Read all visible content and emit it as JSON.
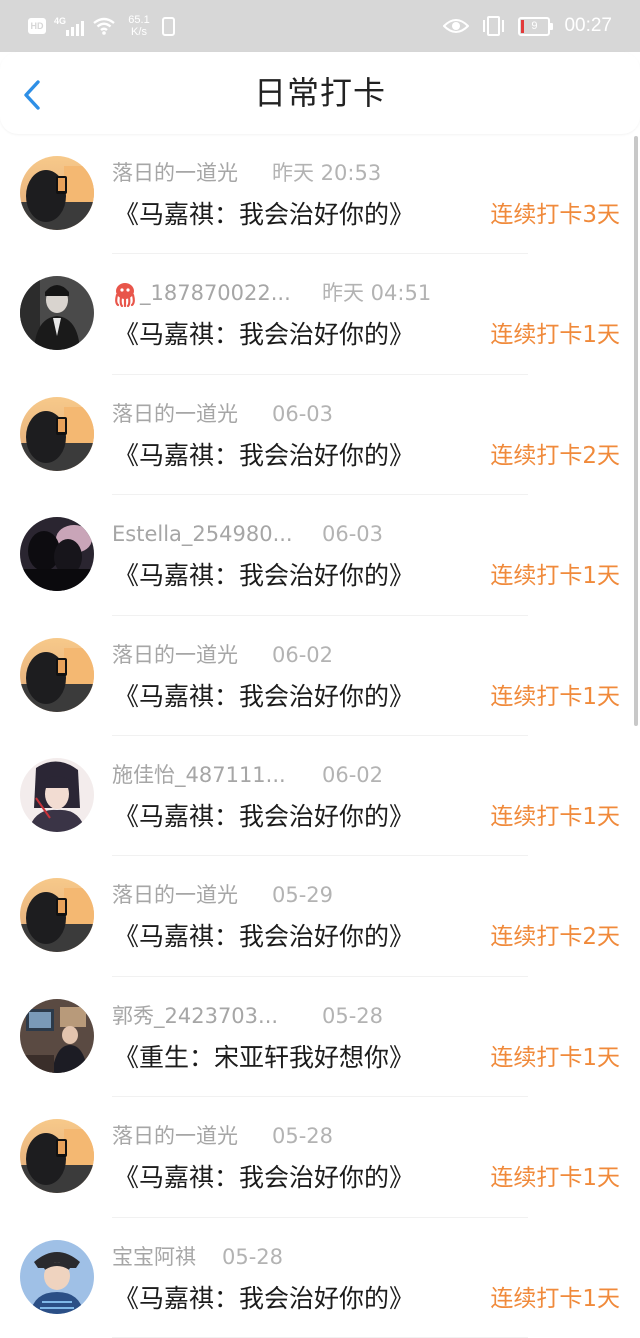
{
  "status_bar": {
    "hd": "HD",
    "network": "4G",
    "speed_value": "65.1",
    "speed_unit": "K/s",
    "battery": "9",
    "time": "00:27"
  },
  "header": {
    "title": "日常打卡",
    "back_icon": "chevron-left-icon"
  },
  "checkins": [
    {
      "user": "落日的一道光",
      "time": "昨天 20:53",
      "book": "《马嘉祺：我会治好你的》",
      "streak": "连续打卡3天"
    },
    {
      "user": "_187870022...",
      "user_emoji": "octopus",
      "time": "昨天 04:51",
      "book": "《马嘉祺：我会治好你的》",
      "streak": "连续打卡1天"
    },
    {
      "user": "落日的一道光",
      "time": "06-03",
      "book": "《马嘉祺：我会治好你的》",
      "streak": "连续打卡2天"
    },
    {
      "user": "Estella_254980...",
      "time": "06-03",
      "book": "《马嘉祺：我会治好你的》",
      "streak": "连续打卡1天"
    },
    {
      "user": "落日的一道光",
      "time": "06-02",
      "book": "《马嘉祺：我会治好你的》",
      "streak": "连续打卡1天"
    },
    {
      "user": "施佳怡_487111...",
      "time": "06-02",
      "book": "《马嘉祺：我会治好你的》",
      "streak": "连续打卡1天"
    },
    {
      "user": "落日的一道光",
      "time": "05-29",
      "book": "《马嘉祺：我会治好你的》",
      "streak": "连续打卡2天"
    },
    {
      "user": "郭秀_2423703...",
      "time": "05-28",
      "book": "《重生：宋亚轩我好想你》",
      "streak": "连续打卡1天"
    },
    {
      "user": "落日的一道光",
      "time": "05-28",
      "book": "《马嘉祺：我会治好你的》",
      "streak": "连续打卡1天"
    },
    {
      "user": "宝宝阿祺",
      "time": "05-28",
      "book": "《马嘉祺：我会治好你的》",
      "streak": "连续打卡1天"
    }
  ],
  "colors": {
    "accent_blue": "#2e8fe6",
    "streak_orange": "#f08a3b",
    "meta_gray": "#a6a6a6"
  }
}
